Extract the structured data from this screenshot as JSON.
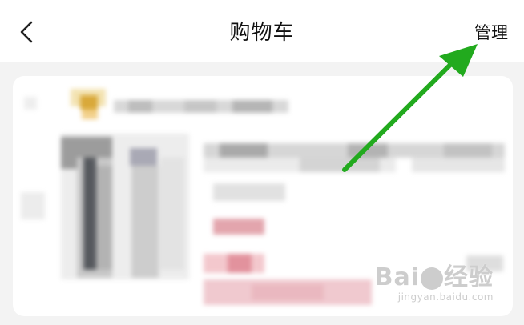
{
  "header": {
    "back_icon": "chevron-left-icon",
    "title": "购物车",
    "manage_label": "管理"
  },
  "card": {
    "content_blurred": true,
    "colors": {
      "store_accent": "#e8b84a",
      "price_tag": "#e3a5ad",
      "promo_band": "#f0c9cf",
      "neutral_blur": "#b8b8b8"
    }
  },
  "annotation": {
    "arrow_color": "#22aa1e",
    "arrow_points_to": "manage-button"
  },
  "watermark": {
    "logo_text_left": "Bai",
    "logo_text_right": "经验",
    "url": "jingyan.baidu.com"
  }
}
